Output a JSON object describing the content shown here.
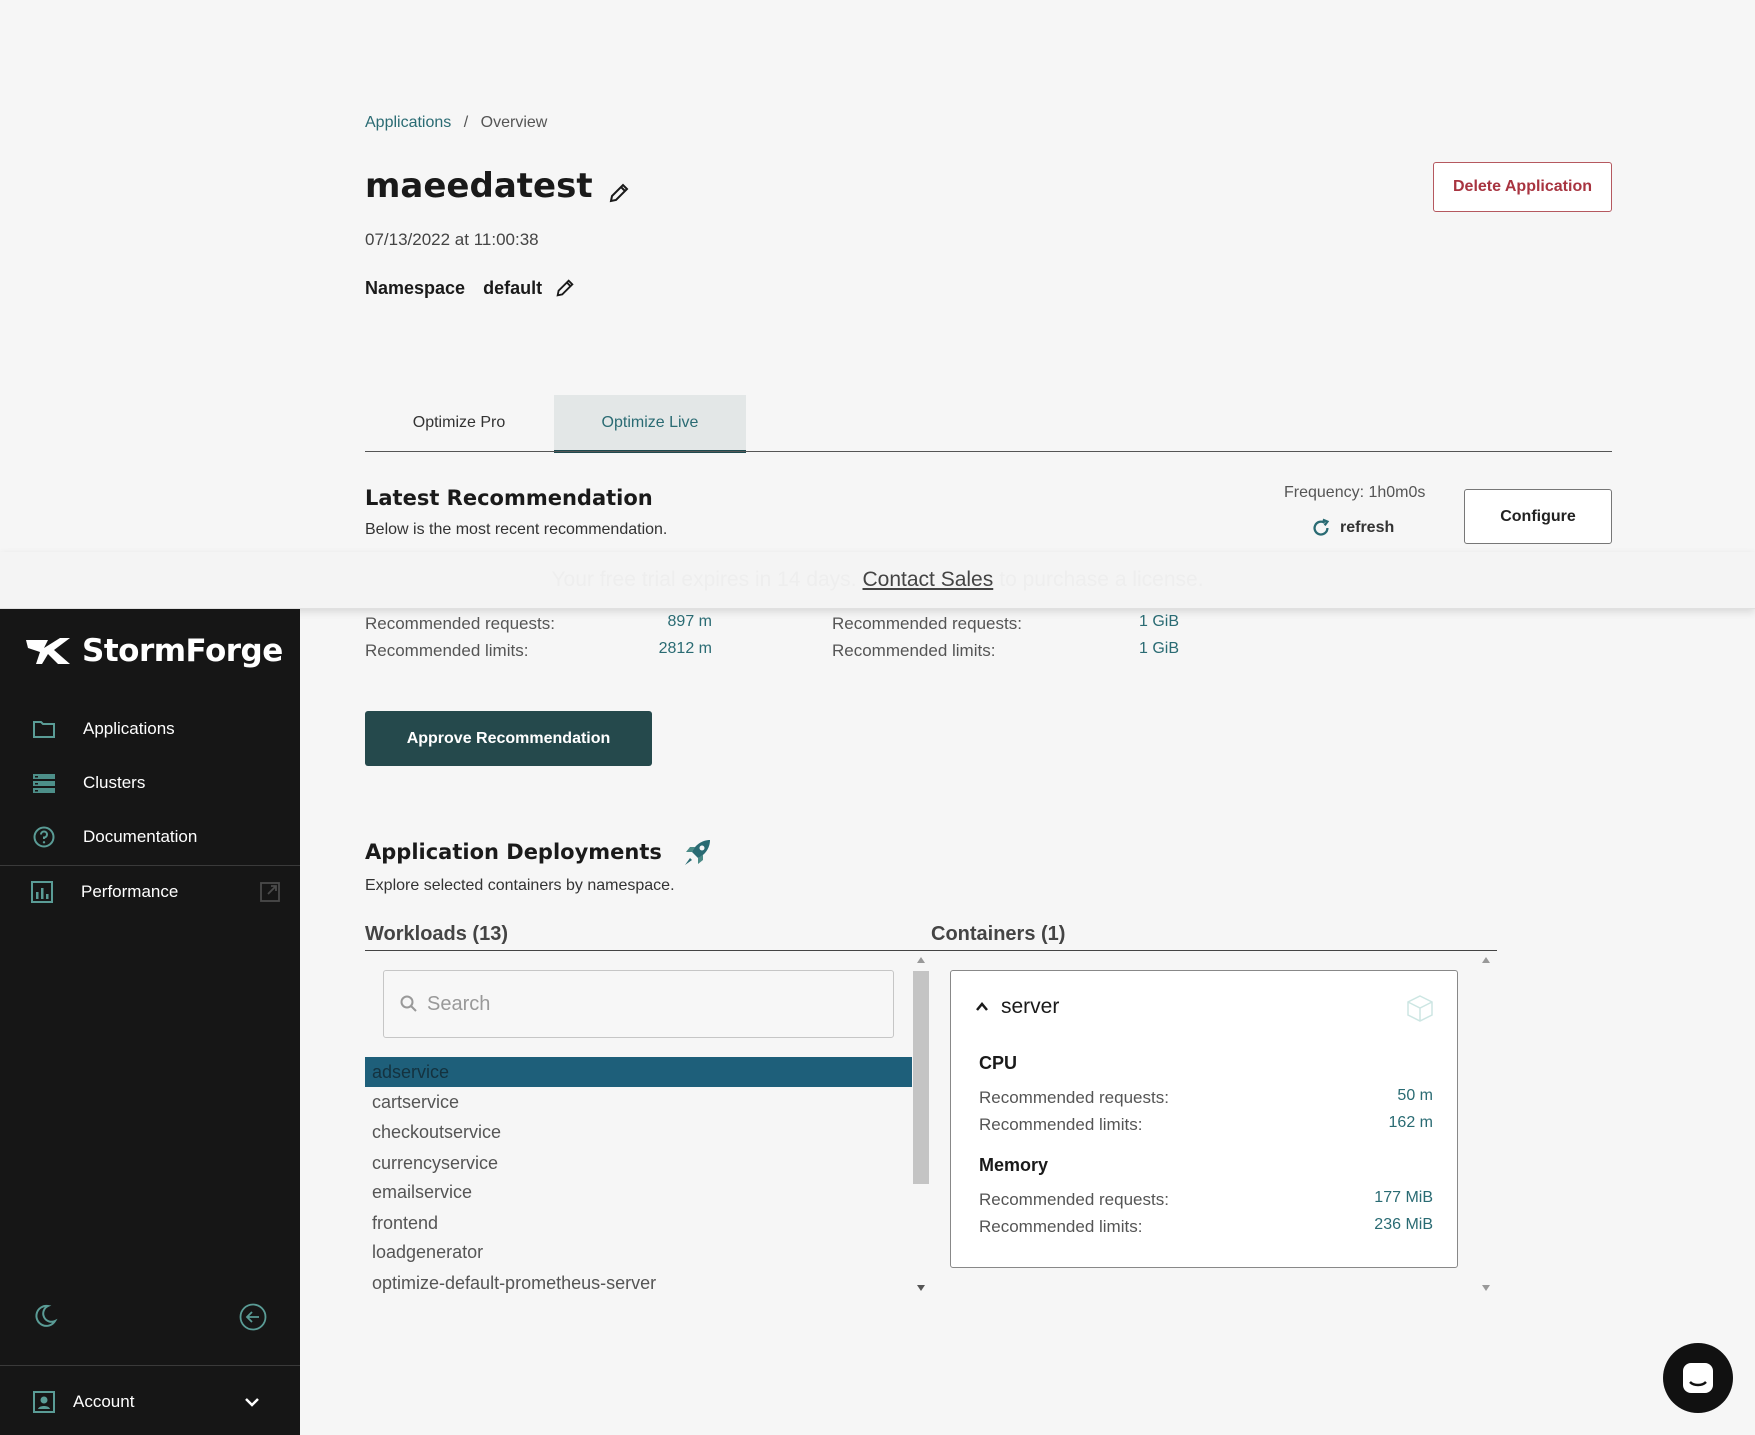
{
  "breadcrumb": {
    "root": "Applications",
    "sep": "/",
    "current": "Overview"
  },
  "app": {
    "name": "maeedatest",
    "datetime": "07/13/2022 at 11:00:38",
    "namespace_label": "Namespace",
    "namespace_value": "default",
    "delete_label": "Delete Application"
  },
  "tabs": [
    {
      "label": "Optimize Pro",
      "active": false
    },
    {
      "label": "Optimize Live",
      "active": true
    }
  ],
  "latest": {
    "title": "Latest Recommendation",
    "subtitle": "Below is the most recent recommendation.",
    "frequency": "Frequency: 1h0m0s",
    "refresh_label": "refresh",
    "configure_label": "Configure",
    "cpu": {
      "requests_label": "Recommended requests:",
      "requests_value": "897 m",
      "limits_label": "Recommended limits:",
      "limits_value": "2812 m"
    },
    "memory": {
      "requests_label": "Recommended requests:",
      "requests_value": "1 GiB",
      "limits_label": "Recommended limits:",
      "limits_value": "1 GiB"
    },
    "approve_label": "Approve Recommendation"
  },
  "banner": {
    "before": "Your free trial expires in 14 days.",
    "link": "Contact Sales",
    "after": "to purchase a license."
  },
  "deployments": {
    "title": "Application Deployments",
    "subtitle": "Explore selected containers by namespace.",
    "workloads_title": "Workloads (13)",
    "containers_title": "Containers (1)",
    "search_placeholder": "Search",
    "workloads": [
      "adservice",
      "cartservice",
      "checkoutservice",
      "currencyservice",
      "emailservice",
      "frontend",
      "loadgenerator",
      "optimize-default-prometheus-server"
    ],
    "selected_index": 0,
    "container": {
      "name": "server",
      "cpu_title": "CPU",
      "cpu_requests_label": "Recommended requests:",
      "cpu_requests_value": "50 m",
      "cpu_limits_label": "Recommended limits:",
      "cpu_limits_value": "162 m",
      "mem_title": "Memory",
      "mem_requests_label": "Recommended requests:",
      "mem_requests_value": "177 MiB",
      "mem_limits_label": "Recommended limits:",
      "mem_limits_value": "236 MiB"
    }
  },
  "sidebar": {
    "brand": "StormForge",
    "items": [
      {
        "label": "Applications",
        "icon": "folder-icon"
      },
      {
        "label": "Clusters",
        "icon": "server-stack-icon"
      },
      {
        "label": "Documentation",
        "icon": "help-circle-icon"
      },
      {
        "label": "Performance",
        "icon": "bar-chart-icon"
      }
    ],
    "account_label": "Account"
  },
  "colors": {
    "accent": "#2a6b73",
    "primary_button": "#25494c",
    "selected_row": "#1e5f7a",
    "danger": "#a83440",
    "sidebar_bg": "#161616"
  }
}
